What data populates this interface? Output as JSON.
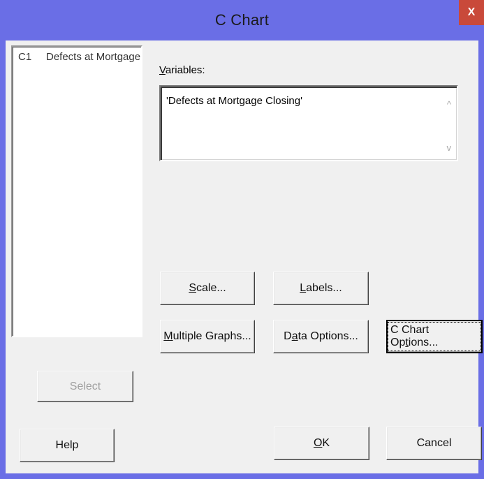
{
  "window": {
    "title": "C Chart",
    "close_label": "X"
  },
  "columns_list": {
    "items": [
      {
        "id": "C1",
        "name": "Defects at Mortgage"
      }
    ]
  },
  "variables": {
    "label_first": "V",
    "label_rest": "ariables:",
    "value": "'Defects at Mortgage Closing'",
    "scroll_up_glyph": "^",
    "scroll_down_glyph": "v"
  },
  "buttons": {
    "scale": {
      "mn": "S",
      "rest": "cale..."
    },
    "labels": {
      "mn": "L",
      "rest": "abels..."
    },
    "multiple_graphs": {
      "mn": "M",
      "rest": "ultiple Graphs..."
    },
    "data_options": {
      "pre": "D",
      "mn": "a",
      "rest": "ta Options..."
    },
    "c_chart_options": {
      "pre": "C Chart Op",
      "mn": "t",
      "rest": "ions..."
    },
    "select": "Select",
    "help": "Help",
    "ok": {
      "mn": "O",
      "rest": "K"
    },
    "cancel": "Cancel"
  },
  "colors": {
    "titlebar": "#6a6ee6",
    "close": "#c9493a",
    "dialog_bg": "#f0f0f0"
  }
}
